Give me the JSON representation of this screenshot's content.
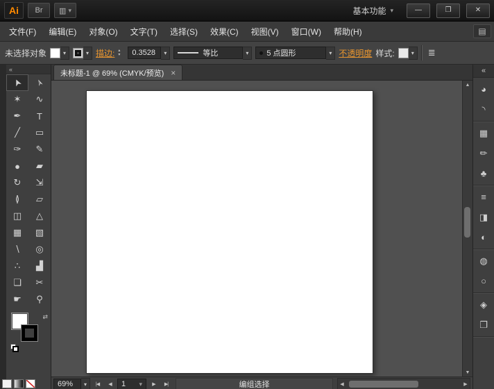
{
  "colors": {
    "accent_orange": "#e8952f",
    "logo_orange": "#ff8a00",
    "panel_gray": "#3f3f3f",
    "canvas_gray": "#505050",
    "artboard_white": "#ffffff"
  },
  "title_bar": {
    "app_logo": "Ai",
    "bridge_label": "Br",
    "arrange_icon_glyph": "▥",
    "workspace_menu_label": "基本功能",
    "chevron": "▾",
    "minimize_glyph": "—",
    "maximize_glyph": "❐",
    "close_glyph": "✕"
  },
  "menu_bar": {
    "items": [
      "文件(F)",
      "编辑(E)",
      "对象(O)",
      "文字(T)",
      "选择(S)",
      "效果(C)",
      "视图(V)",
      "窗口(W)",
      "帮助(H)"
    ],
    "panel_icon_glyph": "▤"
  },
  "control_bar": {
    "selection_status": "未选择对象",
    "stroke_label": "描边:",
    "stroke_weight": "0.3528",
    "width_profile": "等比",
    "brush_name": "5 点圆形",
    "opacity_label": "不透明度",
    "style_label": "样式:",
    "options_icon_glyph": "≣",
    "chevron": "▾",
    "spin_up": "▴",
    "spin_down": "▾"
  },
  "tools_panel": {
    "collapse_glyph": "«",
    "swap_glyph": "⇄"
  },
  "tools": [
    {
      "name": "selection-tool",
      "glyph": "➤"
    },
    {
      "name": "direct-selection-tool",
      "glyph": "➢"
    },
    {
      "name": "magic-wand-tool",
      "glyph": "✶"
    },
    {
      "name": "lasso-tool",
      "glyph": "∿"
    },
    {
      "name": "pen-tool",
      "glyph": "✒"
    },
    {
      "name": "type-tool",
      "glyph": "T"
    },
    {
      "name": "line-segment-tool",
      "glyph": "╱"
    },
    {
      "name": "rectangle-tool",
      "glyph": "▭"
    },
    {
      "name": "paintbrush-tool",
      "glyph": "✑"
    },
    {
      "name": "pencil-tool",
      "glyph": "✎"
    },
    {
      "name": "blob-brush-tool",
      "glyph": "●"
    },
    {
      "name": "eraser-tool",
      "glyph": "▰"
    },
    {
      "name": "rotate-tool",
      "glyph": "↻"
    },
    {
      "name": "scale-tool",
      "glyph": "⇲"
    },
    {
      "name": "width-tool",
      "glyph": "≬"
    },
    {
      "name": "free-transform-tool",
      "glyph": "▱"
    },
    {
      "name": "shape-builder-tool",
      "glyph": "◫"
    },
    {
      "name": "perspective-grid-tool",
      "glyph": "△"
    },
    {
      "name": "mesh-tool",
      "glyph": "▦"
    },
    {
      "name": "gradient-tool",
      "glyph": "▧"
    },
    {
      "name": "eyedropper-tool",
      "glyph": "∖"
    },
    {
      "name": "blend-tool",
      "glyph": "◎"
    },
    {
      "name": "symbol-sprayer-tool",
      "glyph": "∴"
    },
    {
      "name": "column-graph-tool",
      "glyph": "▟"
    },
    {
      "name": "artboard-tool",
      "glyph": "❏"
    },
    {
      "name": "slice-tool",
      "glyph": "✂"
    },
    {
      "name": "hand-tool",
      "glyph": "☛"
    },
    {
      "name": "zoom-tool",
      "glyph": "⚲"
    }
  ],
  "document": {
    "tab_title": "未标题-1 @ 69% (CMYK/预览)",
    "close_glyph": "×",
    "zoom": "69%",
    "artboard_number": "1",
    "status_text": "编组选择",
    "chevron": "▾",
    "nav": {
      "first": "|◀",
      "prev": "◀",
      "next": "▶",
      "last": "▶|"
    },
    "scroll": {
      "up": "▲",
      "down": "▼",
      "left": "◀",
      "right": "▶"
    }
  },
  "right_dock": {
    "collapse_glyph": "«",
    "groups": [
      [
        {
          "name": "color-panel-icon",
          "glyph": "◕"
        },
        {
          "name": "color-guide-panel-icon",
          "glyph": "◝"
        }
      ],
      [
        {
          "name": "swatches-panel-icon",
          "glyph": "▦"
        },
        {
          "name": "brushes-panel-icon",
          "glyph": "✏"
        },
        {
          "name": "symbols-panel-icon",
          "glyph": "♣"
        }
      ],
      [
        {
          "name": "stroke-panel-icon",
          "glyph": "≡"
        },
        {
          "name": "gradient-panel-icon",
          "glyph": "◨"
        },
        {
          "name": "transparency-panel-icon",
          "glyph": "◐"
        }
      ],
      [
        {
          "name": "appearance-panel-icon",
          "glyph": "◍"
        },
        {
          "name": "graphic-styles-panel-icon",
          "glyph": "○"
        }
      ],
      [
        {
          "name": "layers-panel-icon",
          "glyph": "◈"
        },
        {
          "name": "artboards-panel-icon",
          "glyph": "❐"
        }
      ]
    ]
  }
}
